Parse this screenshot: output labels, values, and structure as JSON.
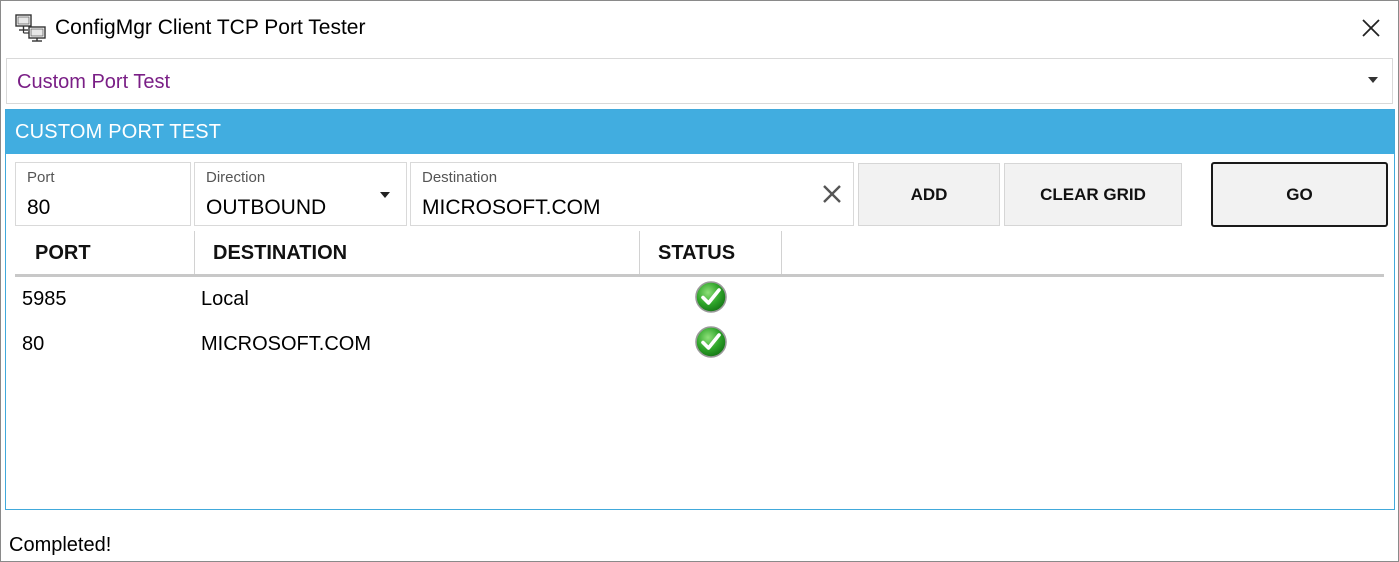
{
  "window": {
    "title": "ConfigMgr Client TCP Port Tester",
    "app_icon": "network-computers-icon",
    "close_icon": "close-icon"
  },
  "mode_select": {
    "value": "Custom Port Test",
    "accent_color": "#7a1f86"
  },
  "panel": {
    "header": "CUSTOM PORT TEST",
    "header_color": "#41ade0"
  },
  "form": {
    "port": {
      "label": "Port",
      "value": "80"
    },
    "direction": {
      "label": "Direction",
      "value": "OUTBOUND"
    },
    "destination": {
      "label": "Destination",
      "value": "MICROSOFT.COM"
    },
    "add_label": "ADD",
    "clear_grid_label": "CLEAR GRID",
    "go_label": "GO"
  },
  "grid": {
    "columns": [
      "PORT",
      "DESTINATION",
      "STATUS"
    ],
    "rows": [
      {
        "port": "5985",
        "destination": "Local",
        "status": "success"
      },
      {
        "port": "80",
        "destination": "MICROSOFT.COM",
        "status": "success"
      }
    ]
  },
  "status_text": "Completed!"
}
